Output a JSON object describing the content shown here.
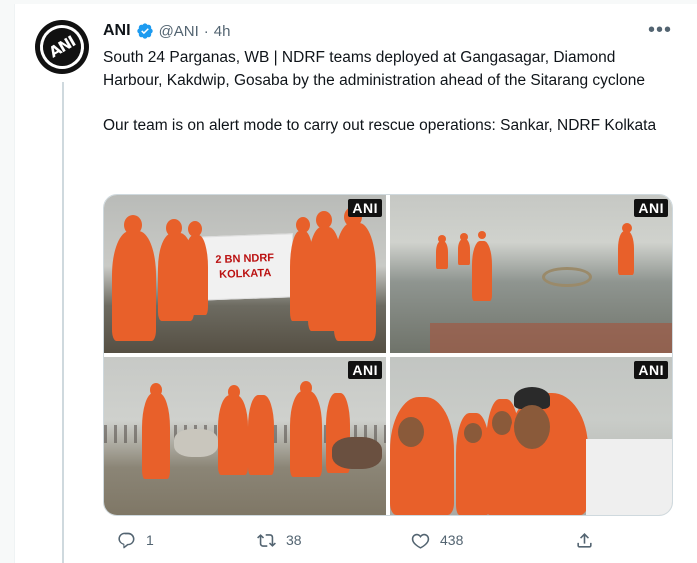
{
  "tweet": {
    "author_name": "ANI",
    "author_handle": "@ANI",
    "separator": "·",
    "time": "4h",
    "more_label": "•••",
    "text": "South 24 Parganas, WB | NDRF teams deployed at Gangasagar, Diamond Harbour, Kakdwip, Gosaba by the administration ahead of the Sitarang cyclone\n\nOur team is on alert mode to carry out rescue operations: Sankar, NDRF Kolkata",
    "avatar_text": "ANI"
  },
  "media": {
    "watermark": "ANI",
    "banner_line1": "2 BN NDRF",
    "banner_line2": "KOLKATA",
    "photos": [
      {
        "alt": "NDRF team in orange raincoats with banner"
      },
      {
        "alt": "NDRF members walking on flooded beach"
      },
      {
        "alt": "NDRF team with cows on shore"
      },
      {
        "alt": "Close-up of NDRF members in raincoats"
      }
    ]
  },
  "actions": {
    "replies": "1",
    "retweets": "38",
    "likes": "438"
  },
  "colors": {
    "accent": "#1d9bf0",
    "muted": "#536471",
    "raincoat": "#e8602a"
  }
}
